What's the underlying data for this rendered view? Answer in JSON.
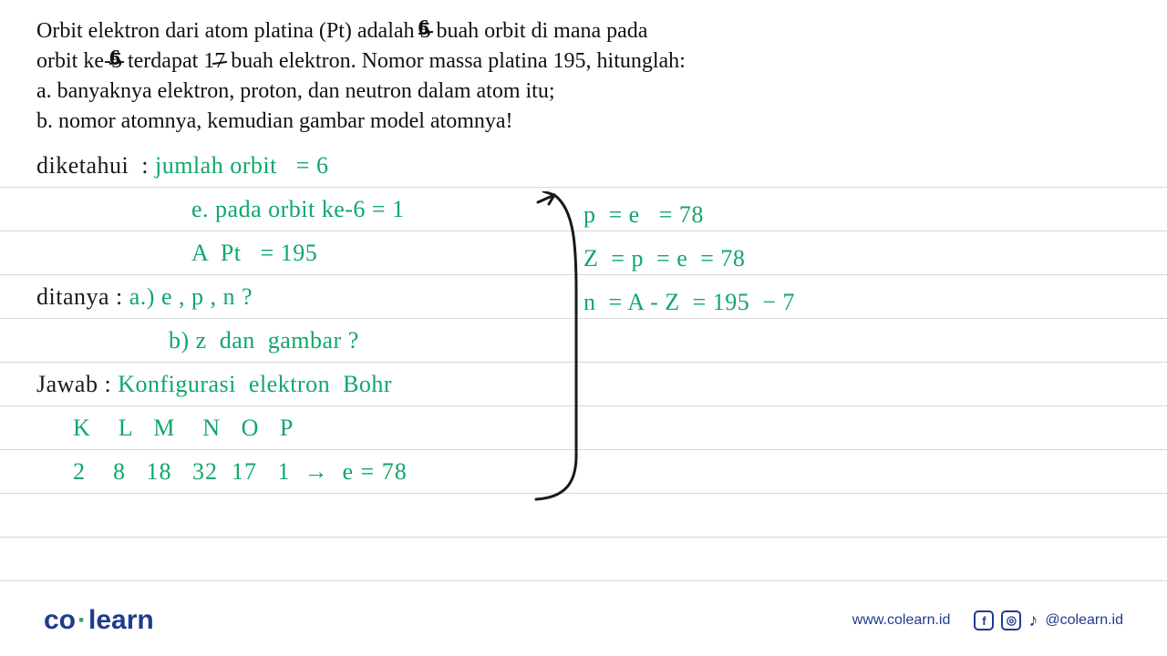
{
  "problem": {
    "line1_a": "Orbit elektron dari atom platina (Pt) adalah ",
    "line1_b_strike": "5",
    "line1_b_over": "6",
    "line1_c": " buah orbit di mana pada",
    "line2_a": "orbit ke-",
    "line2_b_strike": "5",
    "line2_b_over": "6",
    "line2_c": " terdapat 1",
    "line2_d_strike": "7",
    "line2_e": " buah elektron. Nomor massa platina 195, hitunglah:",
    "line3": "a.  banyaknya elektron, proton, dan neutron dalam atom itu;",
    "line4": "b.  nomor atomnya, kemudian gambar model atomnya!"
  },
  "work": {
    "diketahui_label": "diketahui  : ",
    "jumlah_orbit": "jumlah orbit   = 6",
    "e_orbit6": "e. pada orbit ke-6 = 1",
    "A_pt": "A  Pt   = 195",
    "ditanya_label": "ditanya : ",
    "ditanya_a": "a.) e , p , n ?",
    "ditanya_b": "b) z  dan  gambar ?",
    "jawab_label": "Jawab : ",
    "jawab_text": "Konfigurasi  elektron  Bohr",
    "shells": "K    L   M    N   O   P",
    "shell_vals": "2    8   18   32  17   1  →  e = 78"
  },
  "right": {
    "r1": "p  = e   = 78",
    "r2": "Z  = p  = e  = 78",
    "r3": "n  = A - Z  = 195  − 7"
  },
  "footer": {
    "brand_a": "co",
    "brand_b": "learn",
    "url": "www.colearn.id",
    "handle": "@colearn.id"
  }
}
